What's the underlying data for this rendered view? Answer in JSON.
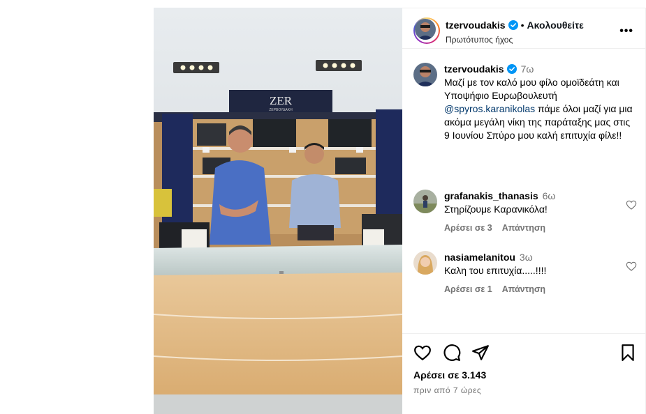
{
  "header": {
    "username": "tzervoudakis",
    "separator": "•",
    "follow_label": "Ακολουθείτε",
    "audio_label": "Πρωτότυπος ήχος",
    "more_icon": "more-horizontal-icon"
  },
  "caption": {
    "username": "tzervoudakis",
    "time": "7ω",
    "text_before": "Μαζί με τον καλό μου φίλο ομοϊδεάτη και Υποψήφιο Ευρωβουλευτή ",
    "mention": "@spyros.karanikolas",
    "text_after": " πάμε όλοι μαζί για μια ακόμα μεγάλη νίκη της παράταξης μας στις 9 Ιουνίου Σπύρο μου καλή επιτυχία φίλε!!"
  },
  "comments": [
    {
      "username": "grafanakis_thanasis",
      "time": "6ω",
      "text": "Στηρίζουμε Καρανικόλα!",
      "likes": "Αρέσει σε 3",
      "reply": "Απάντηση"
    },
    {
      "username": "nasiamelanitou",
      "time": "3ω",
      "text": "Καλη του επιτυχία.....!!!!",
      "likes": "Αρέσει σε 1",
      "reply": "Απάντηση"
    }
  ],
  "media": {
    "store_sign": "ZER",
    "store_sign_sub": "ΖΕΡΒΟΥΔΑΚΗ"
  },
  "footer": {
    "likes": "Αρέσει σε 3.143",
    "time_ago": "πριν από 7 ώρες"
  },
  "colors": {
    "link": "#00376b",
    "secondary_text": "#737373",
    "verified": "#0095f6"
  }
}
